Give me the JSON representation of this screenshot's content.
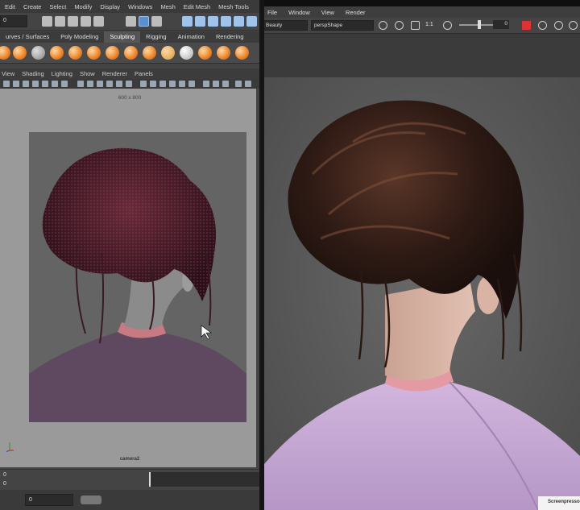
{
  "main": {
    "menubar": [
      "Edit",
      "Create",
      "Select",
      "Modify",
      "Display",
      "Windows",
      "Mesh",
      "Edit Mesh",
      "Mesh Tools"
    ],
    "mode_value": "0",
    "shelf_tabs": [
      {
        "label": "urves / Surfaces",
        "active": false
      },
      {
        "label": "Poly Modeling",
        "active": false
      },
      {
        "label": "Sculpting",
        "active": true
      },
      {
        "label": "Rigging",
        "active": false
      },
      {
        "label": "Animation",
        "active": false
      },
      {
        "label": "Rendering",
        "active": false
      }
    ],
    "viewport_menu": [
      "View",
      "Shading",
      "Lighting",
      "Show",
      "Renderer",
      "Panels"
    ],
    "resolution_gate": "600 x 800",
    "camera_label": "camera2",
    "timeline_start": "0",
    "current_frame": "0",
    "range_start": "0"
  },
  "render_view": {
    "menu": [
      "File",
      "Window",
      "View",
      "Render"
    ],
    "layer_value": "Beauty",
    "camera_value": "perspShape",
    "zoom_label": "1:1",
    "exposure_value": "0"
  },
  "watermark": "Screenpresso",
  "colors": {
    "accent_blue": "#5a8fd0",
    "shelf_orange": "#ef8a2f",
    "hair_dark": "#3a2019",
    "kimono_lilac": "#c7a9d4"
  }
}
